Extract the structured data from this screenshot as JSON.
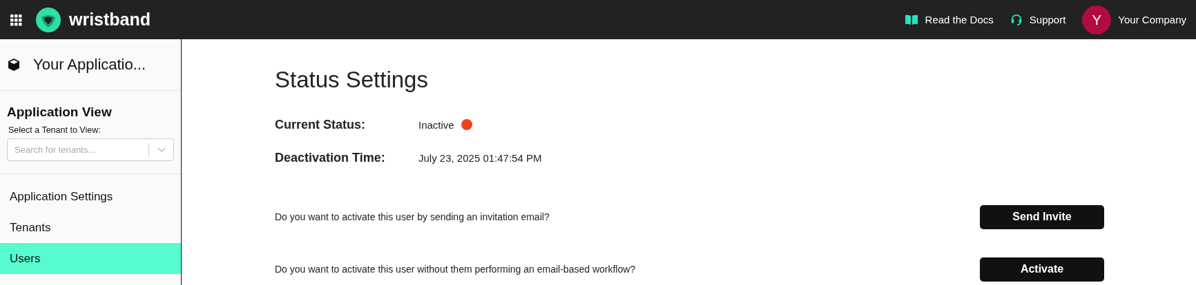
{
  "header": {
    "brand": "wristband",
    "links": [
      {
        "label": "Read the Docs",
        "kind": "docs"
      },
      {
        "label": "Support",
        "kind": "support"
      }
    ],
    "account": {
      "initial": "Y",
      "name": "Your Company",
      "color": "#b00c3f"
    }
  },
  "sidebar": {
    "app_name": "Your Applicatio...",
    "section_title": "Application View",
    "tenant_label": "Select a Tenant to View:",
    "tenant_search": {
      "placeholder": "Search for tenants..."
    },
    "items": [
      {
        "label": "Application Settings",
        "selected": false
      },
      {
        "label": "Tenants",
        "selected": false
      },
      {
        "label": "Users",
        "selected": true
      }
    ]
  },
  "main": {
    "title": "Status Settings",
    "fields": [
      {
        "label": "Current Status:",
        "value": "Inactive",
        "color": "#f4401f"
      },
      {
        "label": "Deactivation Time:",
        "value": "July 23, 2025 01:47:54 PM"
      }
    ],
    "actions": [
      {
        "question": "Do you want to activate this user by sending an invitation email?",
        "button": "Send Invite"
      },
      {
        "question": "Do you want to activate this user without them performing an email-based workflow?",
        "button": "Activate"
      }
    ]
  }
}
